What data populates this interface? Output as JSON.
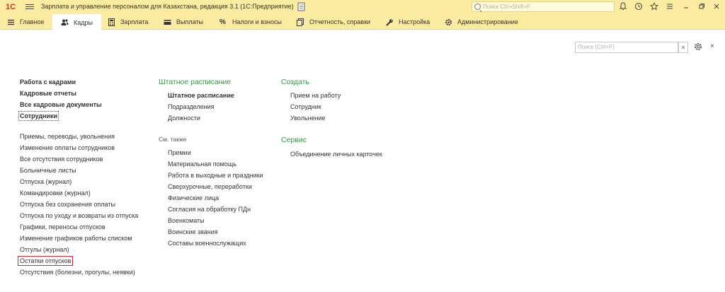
{
  "titlebar": {
    "logo": "1С",
    "title": "Зарплата и управление персоналом для Казахстана, редакция 3.1  (1С:Предприятие)",
    "search_placeholder": "Поиск Ctrl+Shift+F"
  },
  "nav": {
    "items": [
      {
        "label": "Главное"
      },
      {
        "label": "Кадры"
      },
      {
        "label": "Зарплата"
      },
      {
        "label": "Выплаты"
      },
      {
        "label": "Налоги и взносы"
      },
      {
        "label": "Отчетность, справки"
      },
      {
        "label": "Настройка"
      },
      {
        "label": "Администрирование"
      }
    ]
  },
  "content": {
    "search_placeholder": "Поиск (Ctrl+F)",
    "clear_label": "×",
    "close_label": "×",
    "col1": {
      "main_links": [
        "Работа с кадрами",
        "Кадровые отчеты",
        "Все кадровые документы",
        "Сотрудники"
      ],
      "links": [
        "Приемы, переводы, увольнения",
        "Изменение оплаты сотрудников",
        "Все отсутствия сотрудников",
        "Больничные листы",
        "Отпуска (журнал)",
        "Командировки (журнал)",
        "Отпуска без сохранения оплаты",
        "Отпуска по уходу и возвраты из отпуска",
        "Графики, переносы отпусков",
        "Изменение графиков работы списком",
        "Отгулы (журнал)",
        "Остатки отпусков",
        "Отсутствия (болезни, прогулы, неявки)"
      ]
    },
    "col2": {
      "heading": "Штатное расписание",
      "links": [
        "Штатное расписание",
        "Подразделения",
        "Должности"
      ],
      "see_also": "См. также",
      "see_also_links": [
        "Премии",
        "Материальная помощь",
        "Работа в выходные и праздники",
        "Сверхурочные, переработки",
        "Физические лица",
        "Согласия на обработку ПДн",
        "Военкоматы",
        "Воинские звания",
        "Составы военнослужащих"
      ]
    },
    "col3": {
      "create_heading": "Создать",
      "create_links": [
        "Прием на работу",
        "Сотрудник",
        "Увольнение"
      ],
      "service_heading": "Сервис",
      "service_links": [
        "Объединение личных карточек"
      ]
    }
  }
}
